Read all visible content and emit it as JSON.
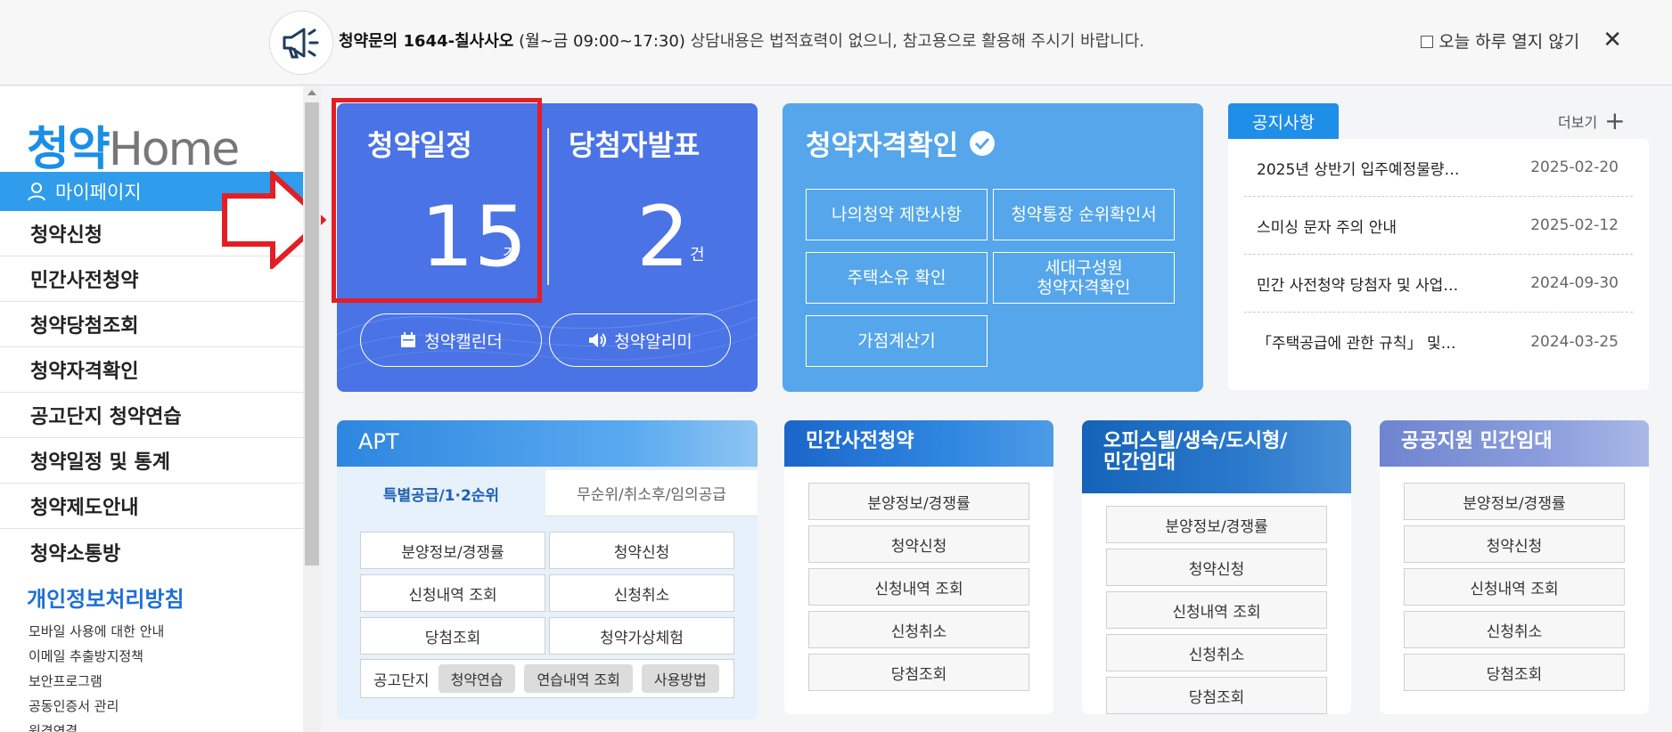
{
  "notice": {
    "phone_bold": "청약문의 1644-칠사사오",
    "hours_bold": "(월~금 09:00~17:30)",
    "message": " 상담내용은 법적효력이 없으니, 참고용으로 활용해 주시기 바랍니다.",
    "dont_show_today": "오늘 하루 열지 않기",
    "close_glyph": "✕"
  },
  "sidebar": {
    "logo_k": "청약",
    "logo_rest": "Home",
    "mypage": "마이페이지",
    "menu": [
      "청약신청",
      "민간사전청약",
      "청약당첨조회",
      "청약자격확인",
      "공고단지 청약연습",
      "청약일정 및 통계",
      "청약제도안내",
      "청약소통방"
    ],
    "privacy": "개인정보처리방침",
    "links": [
      "모바일 사용에 대한 안내",
      "이메일 추출방지정책",
      "보안프로그램",
      "공동인증서 관리",
      "원격연결"
    ]
  },
  "schedule": {
    "label1": "청약일정",
    "count1": "15",
    "unit1": "건",
    "label2": "당첨자발표",
    "count2": "2",
    "unit2": "건",
    "calendar_btn": "청약캘린더",
    "alarm_btn": "청약알리미"
  },
  "qualification": {
    "title": "청약자격확인",
    "buttons": [
      "나의청약 제한사항",
      "청약통장 순위확인서",
      "주택소유 확인",
      "세대구성원\n청약자격확인",
      "가점계산기"
    ]
  },
  "notices": {
    "tab": "공지사항",
    "more": "더보기",
    "items": [
      {
        "title": "2025년 상반기 입주예정물량…",
        "date": "2025-02-20"
      },
      {
        "title": "스미싱 문자 주의 안내",
        "date": "2025-02-12"
      },
      {
        "title": "민간 사전청약 당첨자 및 사업…",
        "date": "2024-09-30"
      },
      {
        "title": "「주택공급에 관한 규칙」 및…",
        "date": "2024-03-25"
      }
    ]
  },
  "apt": {
    "title": "APT",
    "tab_active": "특별공급/1·2순위",
    "tab_inactive": "무순위/취소후/임의공급",
    "buttons": [
      "분양정보/경쟁률",
      "청약신청",
      "신청내역 조회",
      "신청취소",
      "당첨조회",
      "청약가상체험"
    ],
    "gong_label": "공고단지",
    "gong_buttons": [
      "청약연습",
      "연습내역 조회",
      "사용방법"
    ]
  },
  "private_pre": {
    "title": "민간사전청약",
    "buttons": [
      "분양정보/경쟁률",
      "청약신청",
      "신청내역 조회",
      "신청취소",
      "당첨조회"
    ]
  },
  "officetel": {
    "title": "오피스텔/생숙/도시형/\n민간임대",
    "buttons": [
      "분양정보/경쟁률",
      "청약신청",
      "신청내역 조회",
      "신청취소",
      "당첨조회"
    ]
  },
  "public_rent": {
    "title": "공공지원 민간임대",
    "buttons": [
      "분양정보/경쟁률",
      "청약신청",
      "신청내역 조회",
      "신청취소",
      "당첨조회"
    ]
  }
}
